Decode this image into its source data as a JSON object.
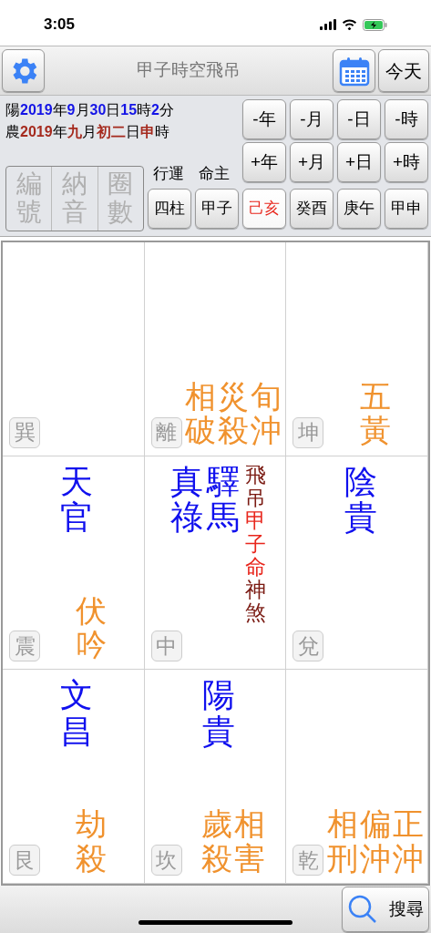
{
  "status_bar": {
    "time": "3:05"
  },
  "header": {
    "title": "甲子時空飛吊",
    "today_button": "今天"
  },
  "date_lines": [
    {
      "kind": "solar",
      "parts": [
        {
          "text": "陽",
          "highlight": false
        },
        {
          "text": "2019",
          "highlight": true
        },
        {
          "text": "年",
          "highlight": false
        },
        {
          "text": "9",
          "highlight": true
        },
        {
          "text": "月",
          "highlight": false
        },
        {
          "text": "30",
          "highlight": true
        },
        {
          "text": "日",
          "highlight": false
        },
        {
          "text": "15",
          "highlight": true
        },
        {
          "text": "時",
          "highlight": false
        },
        {
          "text": "2",
          "highlight": true
        },
        {
          "text": "分",
          "highlight": false
        }
      ]
    },
    {
      "kind": "lunar",
      "parts": [
        {
          "text": "農",
          "highlight": false
        },
        {
          "text": "2019",
          "highlight": true
        },
        {
          "text": "年",
          "highlight": false
        },
        {
          "text": "九",
          "highlight": true
        },
        {
          "text": "月",
          "highlight": false
        },
        {
          "text": "初二",
          "highlight": true
        },
        {
          "text": "日",
          "highlight": false
        },
        {
          "text": "申",
          "highlight": true
        },
        {
          "text": "時",
          "highlight": false
        }
      ]
    }
  ],
  "minus_buttons": [
    "-年",
    "-月",
    "-日",
    "-時"
  ],
  "plus_buttons": [
    "+年",
    "+月",
    "+日",
    "+時"
  ],
  "mode_buttons": [
    {
      "label": "編號",
      "disabled": true
    },
    {
      "label": "納音",
      "disabled": true
    },
    {
      "label": "圈數",
      "disabled": true
    }
  ],
  "pillar_captions": [
    "行運",
    "命主"
  ],
  "pillar_buttons": [
    {
      "label": "四柱",
      "selected": false
    },
    {
      "label": "甲子",
      "selected": false
    },
    {
      "label": "己亥",
      "selected": true
    },
    {
      "label": "癸酉",
      "selected": false
    },
    {
      "label": "庚午",
      "selected": false
    },
    {
      "label": "甲申",
      "selected": false
    }
  ],
  "grid": [
    {
      "trigram": "巽"
    },
    {
      "trigram": "離",
      "lower": [
        "相破",
        "災殺",
        "旬沖"
      ]
    },
    {
      "trigram": "坤",
      "lower": [
        "五黃"
      ]
    },
    {
      "trigram": "震",
      "upper": [
        "天官"
      ],
      "lower": [
        "伏吟"
      ]
    },
    {
      "trigram": "中",
      "upper": [
        "真祿",
        "驛馬"
      ],
      "side": [
        {
          "text": "飛吊",
          "color": "#7a1a12"
        },
        {
          "text": "甲子命",
          "color": "#e8261c"
        },
        {
          "text": "神煞",
          "color": "#7a1a12"
        }
      ]
    },
    {
      "trigram": "兌",
      "upper": [
        "陰貴"
      ]
    },
    {
      "trigram": "艮",
      "upper": [
        "文昌"
      ],
      "lower": [
        "劫殺"
      ]
    },
    {
      "trigram": "坎",
      "upper": [
        "陽貴"
      ],
      "lower": [
        "歲殺",
        "相害"
      ]
    },
    {
      "trigram": "乾",
      "lower": [
        "相刑",
        "偏沖",
        "正沖"
      ]
    }
  ],
  "search_button": "搜尋"
}
